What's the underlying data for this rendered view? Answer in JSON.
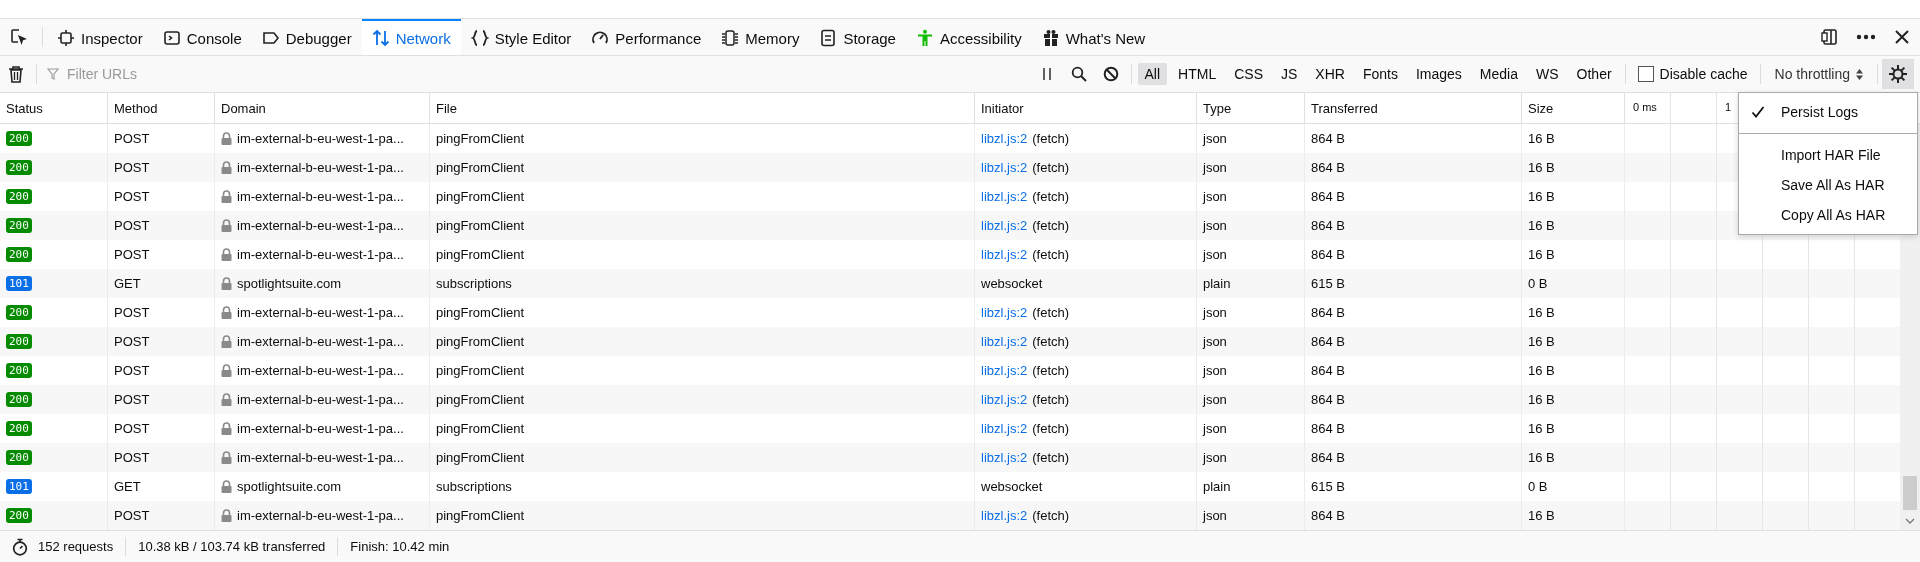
{
  "tabs": [
    {
      "label": "Inspector",
      "selected": false
    },
    {
      "label": "Console",
      "selected": false
    },
    {
      "label": "Debugger",
      "selected": false
    },
    {
      "label": "Network",
      "selected": true
    },
    {
      "label": "Style Editor",
      "selected": false
    },
    {
      "label": "Performance",
      "selected": false
    },
    {
      "label": "Memory",
      "selected": false
    },
    {
      "label": "Storage",
      "selected": false
    },
    {
      "label": "Accessibility",
      "selected": false
    },
    {
      "label": "What's New",
      "selected": false
    }
  ],
  "filter": {
    "placeholder": "Filter URLs"
  },
  "type_filters": [
    {
      "label": "All",
      "selected": true
    },
    {
      "label": "HTML",
      "selected": false
    },
    {
      "label": "CSS",
      "selected": false
    },
    {
      "label": "JS",
      "selected": false
    },
    {
      "label": "XHR",
      "selected": false
    },
    {
      "label": "Fonts",
      "selected": false
    },
    {
      "label": "Images",
      "selected": false
    },
    {
      "label": "Media",
      "selected": false
    },
    {
      "label": "WS",
      "selected": false
    },
    {
      "label": "Other",
      "selected": false
    }
  ],
  "disable_cache": {
    "label": "Disable cache",
    "checked": false
  },
  "throttling": {
    "value": "No throttling"
  },
  "table": {
    "columns": [
      "Status",
      "Method",
      "Domain",
      "File",
      "Initiator",
      "Type",
      "Transferred",
      "Size"
    ],
    "waterfall_ticks": [
      "0 ms",
      "1"
    ],
    "rows": [
      {
        "status": "200",
        "color": "#058b00",
        "method": "POST",
        "domain": "im-external-b-eu-west-1-pa...",
        "file": "pingFromClient",
        "initiator": {
          "link": "libzl.js:2",
          "cause": "(fetch)"
        },
        "type": "json",
        "transferred": "864 B",
        "size": "16 B"
      },
      {
        "status": "200",
        "color": "#058b00",
        "method": "POST",
        "domain": "im-external-b-eu-west-1-pa...",
        "file": "pingFromClient",
        "initiator": {
          "link": "libzl.js:2",
          "cause": "(fetch)"
        },
        "type": "json",
        "transferred": "864 B",
        "size": "16 B"
      },
      {
        "status": "200",
        "color": "#058b00",
        "method": "POST",
        "domain": "im-external-b-eu-west-1-pa...",
        "file": "pingFromClient",
        "initiator": {
          "link": "libzl.js:2",
          "cause": "(fetch)"
        },
        "type": "json",
        "transferred": "864 B",
        "size": "16 B"
      },
      {
        "status": "200",
        "color": "#058b00",
        "method": "POST",
        "domain": "im-external-b-eu-west-1-pa...",
        "file": "pingFromClient",
        "initiator": {
          "link": "libzl.js:2",
          "cause": "(fetch)"
        },
        "type": "json",
        "transferred": "864 B",
        "size": "16 B"
      },
      {
        "status": "200",
        "color": "#058b00",
        "method": "POST",
        "domain": "im-external-b-eu-west-1-pa...",
        "file": "pingFromClient",
        "initiator": {
          "link": "libzl.js:2",
          "cause": "(fetch)"
        },
        "type": "json",
        "transferred": "864 B",
        "size": "16 B"
      },
      {
        "status": "101",
        "color": "#0a6ee6",
        "method": "GET",
        "domain": "spotlightsuite.com",
        "file": "subscriptions",
        "initiator": {
          "cause": "websocket"
        },
        "type": "plain",
        "transferred": "615 B",
        "size": "0 B"
      },
      {
        "status": "200",
        "color": "#058b00",
        "method": "POST",
        "domain": "im-external-b-eu-west-1-pa...",
        "file": "pingFromClient",
        "initiator": {
          "link": "libzl.js:2",
          "cause": "(fetch)"
        },
        "type": "json",
        "transferred": "864 B",
        "size": "16 B"
      },
      {
        "status": "200",
        "color": "#058b00",
        "method": "POST",
        "domain": "im-external-b-eu-west-1-pa...",
        "file": "pingFromClient",
        "initiator": {
          "link": "libzl.js:2",
          "cause": "(fetch)"
        },
        "type": "json",
        "transferred": "864 B",
        "size": "16 B"
      },
      {
        "status": "200",
        "color": "#058b00",
        "method": "POST",
        "domain": "im-external-b-eu-west-1-pa...",
        "file": "pingFromClient",
        "initiator": {
          "link": "libzl.js:2",
          "cause": "(fetch)"
        },
        "type": "json",
        "transferred": "864 B",
        "size": "16 B"
      },
      {
        "status": "200",
        "color": "#058b00",
        "method": "POST",
        "domain": "im-external-b-eu-west-1-pa...",
        "file": "pingFromClient",
        "initiator": {
          "link": "libzl.js:2",
          "cause": "(fetch)"
        },
        "type": "json",
        "transferred": "864 B",
        "size": "16 B"
      },
      {
        "status": "200",
        "color": "#058b00",
        "method": "POST",
        "domain": "im-external-b-eu-west-1-pa...",
        "file": "pingFromClient",
        "initiator": {
          "link": "libzl.js:2",
          "cause": "(fetch)"
        },
        "type": "json",
        "transferred": "864 B",
        "size": "16 B"
      },
      {
        "status": "200",
        "color": "#058b00",
        "method": "POST",
        "domain": "im-external-b-eu-west-1-pa...",
        "file": "pingFromClient",
        "initiator": {
          "link": "libzl.js:2",
          "cause": "(fetch)"
        },
        "type": "json",
        "transferred": "864 B",
        "size": "16 B"
      },
      {
        "status": "101",
        "color": "#0a6ee6",
        "method": "GET",
        "domain": "spotlightsuite.com",
        "file": "subscriptions",
        "initiator": {
          "cause": "websocket"
        },
        "type": "plain",
        "transferred": "615 B",
        "size": "0 B"
      },
      {
        "status": "200",
        "color": "#058b00",
        "method": "POST",
        "domain": "im-external-b-eu-west-1-pa...",
        "file": "pingFromClient",
        "initiator": {
          "link": "libzl.js:2",
          "cause": "(fetch)"
        },
        "type": "json",
        "transferred": "864 B",
        "size": "16 B"
      }
    ]
  },
  "settings_menu": {
    "items": [
      {
        "label": "Persist Logs",
        "kind": "check",
        "checked": true
      },
      {
        "label": "Import HAR File",
        "kind": "action"
      },
      {
        "label": "Save All As HAR",
        "kind": "action"
      },
      {
        "label": "Copy All As HAR",
        "kind": "action"
      }
    ]
  },
  "status_bar": {
    "requests": "152 requests",
    "transferred": "10.38 kB / 103.74 kB transferred",
    "finish": "Finish: 10.42 min"
  }
}
